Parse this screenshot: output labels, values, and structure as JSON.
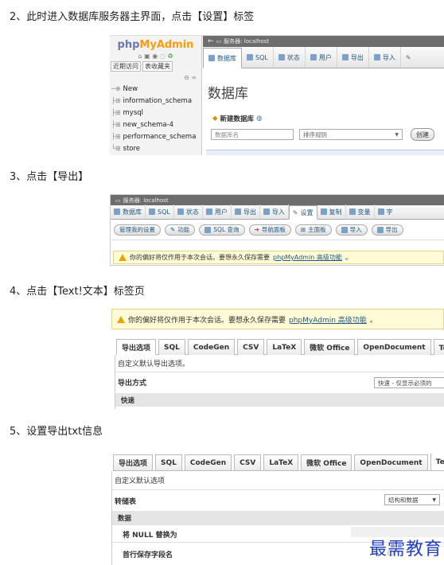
{
  "steps": [
    "2、此时进入数据库服务器主界面，点击【设置】标签",
    "3、点击【导出】",
    "4、点击【Text!文本】标签页",
    "5、设置导出txt信息"
  ],
  "shot1": {
    "logo_php": "php",
    "logo_my": "MyAdmin",
    "nav_recent": "近期访问",
    "nav_fav": "表收藏夹",
    "server_label": "服务器: localhost",
    "tabs": [
      "数据库",
      "SQL",
      "状态",
      "用户",
      "导出",
      "导入"
    ],
    "databases": [
      "New",
      "information_schema",
      "mysql",
      "new_schema-4",
      "performance_schema",
      "store"
    ],
    "heading": "数据库",
    "create_label": "新建数据库",
    "db_name_placeholder": "数据库名",
    "collation_placeholder": "排序规则",
    "create_button": "创建"
  },
  "shot2": {
    "server_label": "服务器: localhost",
    "tabs": [
      "数据库",
      "SQL",
      "状态",
      "用户",
      "导出",
      "导入",
      "设置",
      "复制",
      "变量",
      "字"
    ],
    "subbuttons": [
      "管理我的设置",
      "功能",
      "SQL 查询",
      "导航面板",
      "主面板",
      "导入",
      "导出"
    ],
    "warn_text": "你的偏好将仅作用于本次会话。要想永久保存需要",
    "warn_link": "phpMyAdmin 高级功能",
    "warn_end": "。"
  },
  "shot3": {
    "warn_text": "你的偏好将仅作用于本次会话。要想永久保存需要",
    "warn_link": "phpMyAdmin 高级功能",
    "warn_end": "。",
    "tabs": [
      "导出选项",
      "SQL",
      "CodeGen",
      "CSV",
      "LaTeX",
      "微软 Office",
      "OpenDocument",
      "Texy! 文"
    ],
    "subtitle": "自定义默认导出选项。",
    "method_label": "导出方式",
    "method_value": "快速 - 仅显示必须的",
    "quick_label": "快速"
  },
  "shot4": {
    "tabs": [
      "导出选项",
      "SQL",
      "CodeGen",
      "CSV",
      "LaTeX",
      "微软 Office",
      "OpenDocument",
      "Texy"
    ],
    "subtitle": "自定义默认选项",
    "dump_label": "转储表",
    "dump_value": "结构和数据",
    "data_label": "数据",
    "null_label": "将 NULL 替换为",
    "first_row_label": "首行保存字段名"
  },
  "watermark": "最需教育"
}
